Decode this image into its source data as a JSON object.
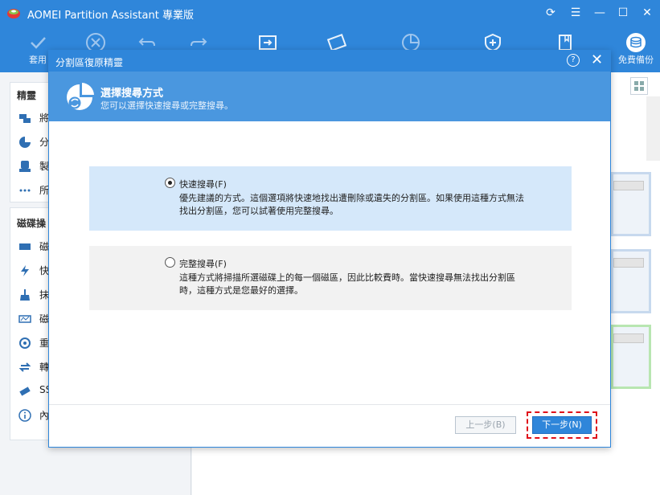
{
  "app": {
    "title": "AOMEI Partition Assistant 專業版",
    "toolbar": {
      "apply_label": "套用",
      "backup_label": "免費備份"
    }
  },
  "sidebar": {
    "section1_title": "精靈",
    "section1_items": [
      "將",
      "分",
      "製",
      "所"
    ],
    "section2_title": "磁碟操",
    "section2_items": [
      "磁",
      "快",
      "抹",
      "磁",
      "重",
      "轉",
      "SS",
      "內"
    ]
  },
  "dialog": {
    "title": "分割區復原精靈",
    "help_label": "?",
    "header_title": "選擇搜尋方式",
    "header_subtitle": "您可以選擇快速搜尋或完整搜尋。",
    "options": [
      {
        "label": "快速搜尋(F)",
        "selected": true,
        "desc": "優先建議的方式。這個選項將快速地找出遭刪除或遺失的分割區。如果使用這種方式無法找出分割區，您可以試著使用完整搜尋。"
      },
      {
        "label": "完整搜尋(F)",
        "selected": false,
        "desc": "這種方式將掃描所選磁碟上的每一個磁區，因此比較費時。當快速搜尋無法找出分割區時，這種方式是您最好的選擇。"
      }
    ],
    "prev_button": "上一步(B)",
    "next_button": "下一步(N)"
  },
  "colors": {
    "accent": "#2f86da",
    "header": "#4a97df",
    "selected_option": "#d5e8fa",
    "highlight": "#e0101a"
  }
}
